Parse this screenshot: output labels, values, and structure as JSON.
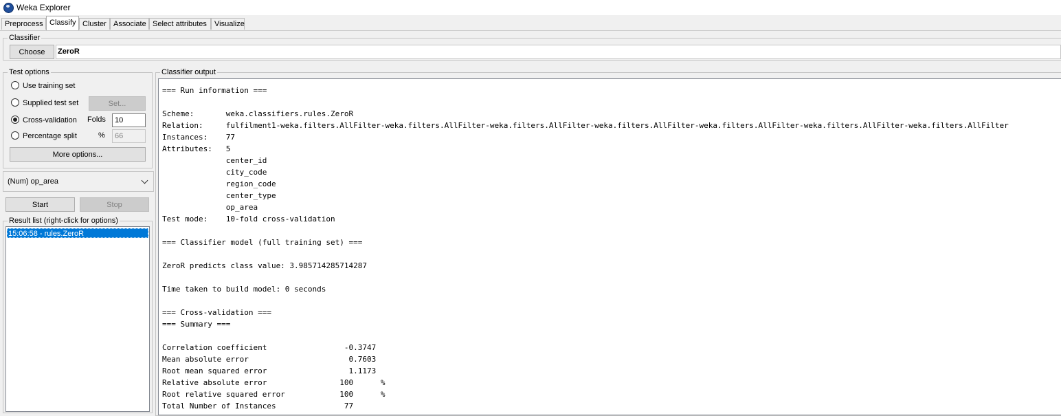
{
  "window": {
    "title": "Weka Explorer"
  },
  "tabs": [
    {
      "label": "Preprocess",
      "active": false
    },
    {
      "label": "Classify",
      "active": true
    },
    {
      "label": "Cluster",
      "active": false
    },
    {
      "label": "Associate",
      "active": false
    },
    {
      "label": "Select attributes",
      "active": false
    },
    {
      "label": "Visualize",
      "active": false
    }
  ],
  "classifier": {
    "group_label": "Classifier",
    "choose_label": "Choose",
    "name": "ZeroR"
  },
  "test_options": {
    "group_label": "Test options",
    "use_training_set": "Use training set",
    "supplied_test_set": "Supplied test set",
    "set_label": "Set...",
    "cross_validation": "Cross-validation",
    "folds_label": "Folds",
    "folds_value": "10",
    "percentage_split": "Percentage split",
    "percent_symbol": "%",
    "percent_value": "66",
    "more_options": "More options...",
    "selected": "cross-validation"
  },
  "class_select": {
    "value": "(Num) op_area"
  },
  "actions": {
    "start": "Start",
    "stop": "Stop"
  },
  "result_list": {
    "group_label": "Result list (right-click for options)",
    "items": [
      "15:06:58 - rules.ZeroR"
    ]
  },
  "output": {
    "group_label": "Classifier output",
    "text": "=== Run information ===\n\nScheme:       weka.classifiers.rules.ZeroR \nRelation:     fulfilment1-weka.filters.AllFilter-weka.filters.AllFilter-weka.filters.AllFilter-weka.filters.AllFilter-weka.filters.AllFilter-weka.filters.AllFilter-weka.filters.AllFilter\nInstances:    77\nAttributes:   5\n              center_id\n              city_code\n              region_code\n              center_type\n              op_area\nTest mode:    10-fold cross-validation\n\n=== Classifier model (full training set) ===\n\nZeroR predicts class value: 3.985714285714287\n\nTime taken to build model: 0 seconds\n\n=== Cross-validation ===\n=== Summary ===\n\nCorrelation coefficient                 -0.3747\nMean absolute error                      0.7603\nRoot mean squared error                  1.1173\nRelative absolute error                100      %\nRoot relative squared error            100      %\nTotal Number of Instances               77     "
  }
}
